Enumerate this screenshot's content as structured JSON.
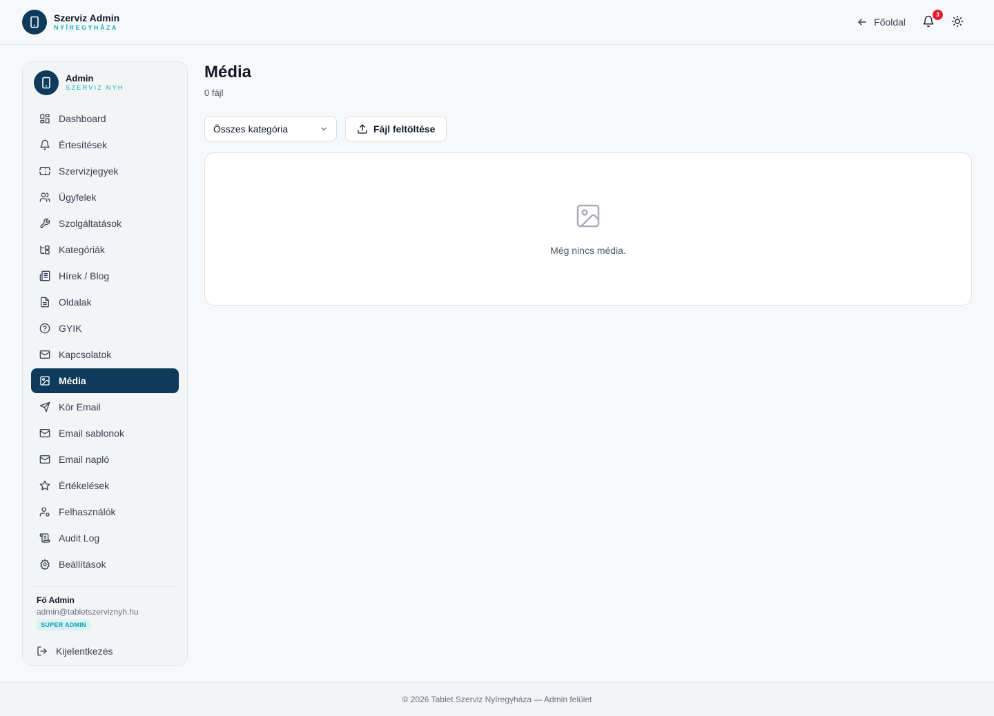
{
  "header": {
    "brand_title": "Szerviz Admin",
    "brand_subtitle": "NYÍREGYHÁZA",
    "home_label": "Főoldal",
    "notification_count": "3"
  },
  "sidebar": {
    "brand_title": "Admin",
    "brand_subtitle": "SZERVIZ NYH",
    "items": [
      {
        "label": "Dashboard",
        "icon": "dashboard-icon"
      },
      {
        "label": "Értesítések",
        "icon": "bell-icon"
      },
      {
        "label": "Szervizjegyek",
        "icon": "ticket-icon"
      },
      {
        "label": "Ügyfelek",
        "icon": "users-icon"
      },
      {
        "label": "Szolgáltatások",
        "icon": "wrench-icon"
      },
      {
        "label": "Kategóriák",
        "icon": "tree-icon"
      },
      {
        "label": "Hírek / Blog",
        "icon": "newspaper-icon"
      },
      {
        "label": "Oldalak",
        "icon": "file-icon"
      },
      {
        "label": "GYIK",
        "icon": "help-icon"
      },
      {
        "label": "Kapcsolatok",
        "icon": "mail-icon"
      },
      {
        "label": "Média",
        "icon": "image-icon",
        "active": true
      },
      {
        "label": "Kör Email",
        "icon": "send-icon"
      },
      {
        "label": "Email sablonok",
        "icon": "mail-icon"
      },
      {
        "label": "Email napló",
        "icon": "mail-icon"
      },
      {
        "label": "Értékelések",
        "icon": "star-icon"
      },
      {
        "label": "Felhasználók",
        "icon": "user-cog-icon"
      },
      {
        "label": "Audit Log",
        "icon": "scroll-icon"
      },
      {
        "label": "Beállítások",
        "icon": "settings-icon"
      }
    ],
    "user": {
      "name": "Fő Admin",
      "email": "admin@tabletszerviznyh.hu",
      "role": "SUPER ADMIN"
    },
    "logout_label": "Kijelentkezés"
  },
  "main": {
    "title": "Média",
    "subtitle": "0 fájl",
    "category_select": "Összes kategória",
    "upload_label": "Fájl feltöltése",
    "empty_text": "Még nincs média."
  },
  "footer": {
    "text": "© 2026 Tablet Szerviz Nyíregyháza — Admin felület"
  },
  "colors": {
    "primary": "#0e3a5b",
    "accent": "#17b3c4",
    "badge": "#e11d2e"
  }
}
